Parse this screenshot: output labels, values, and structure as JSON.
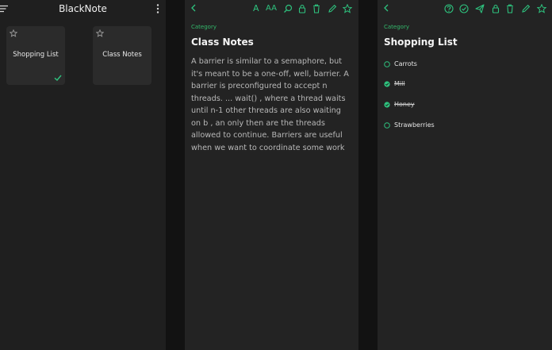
{
  "colors": {
    "accent": "#2ec27e",
    "surface": "#232323",
    "card": "#2b2b2b",
    "background": "#121212"
  },
  "home": {
    "title": "BlackNote",
    "notes": [
      {
        "title": "Shopping List",
        "checked": true
      },
      {
        "title": "Class Notes",
        "checked": false
      }
    ]
  },
  "note": {
    "category": "Category",
    "title": "Class Notes",
    "body": "A barrier is similar to a semaphore, but it's meant to be a one-off, well, barrier. A barrier is preconfigured to accept n threads. ... wait() , where a thread waits until n-1 other threads are also waiting on b , an only then are the threads allowed to continue. Barriers are useful when we want to coordinate some work",
    "toolbar": {
      "font_label": "A",
      "font_size_label": "AA"
    }
  },
  "list": {
    "category": "Category",
    "title": "Shopping List",
    "items": [
      {
        "label": "Carrots",
        "checked": false
      },
      {
        "label": "Mill",
        "checked": true
      },
      {
        "label": "Honey",
        "checked": true
      },
      {
        "label": "Strawberries",
        "checked": false
      }
    ]
  }
}
